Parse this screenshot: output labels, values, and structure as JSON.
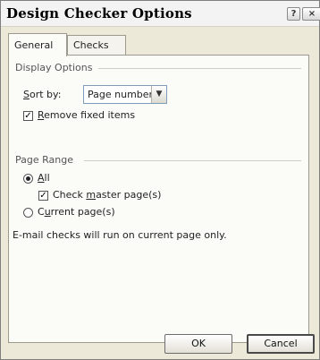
{
  "window": {
    "title": "Design Checker Options"
  },
  "titlebar": {
    "help_glyph": "?",
    "close_glyph": "×"
  },
  "tabs": [
    {
      "label": "General",
      "active": true
    },
    {
      "label": "Checks",
      "active": false
    }
  ],
  "display_options": {
    "title": "Display Options",
    "sort_by": {
      "label_prefix": "",
      "label_underlined": "S",
      "label_rest": "ort by:",
      "selected": "Page number"
    },
    "remove_fixed": {
      "label_underlined": "R",
      "label_rest": "emove fixed items",
      "checked": true
    }
  },
  "page_range": {
    "title": "Page Range",
    "all": {
      "label_underlined": "A",
      "label_rest": "ll",
      "selected": true
    },
    "check_master": {
      "label_prefix": "Check ",
      "label_underlined": "m",
      "label_rest": "aster page(s)",
      "checked": true
    },
    "current": {
      "label_prefix": "C",
      "label_underlined": "u",
      "label_rest": "rrent page(s)",
      "selected": false
    }
  },
  "note": "E-mail checks will run on current page only.",
  "buttons": {
    "ok": "OK",
    "cancel": "Cancel"
  },
  "icons": {
    "dropdown": "chevron-down-icon",
    "check": "checkmark-icon"
  },
  "colors": {
    "dialog_bg": "#ece9d8",
    "panel_bg": "#fbfbf8",
    "input_border": "#7f9db9"
  }
}
